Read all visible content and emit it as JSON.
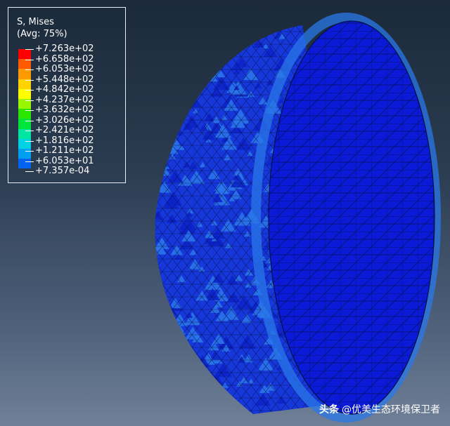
{
  "legend": {
    "variable": "S, Mises",
    "averaging": "(Avg: 75%)",
    "levels": [
      {
        "label": "+7.263e+02",
        "color": "#ff0000"
      },
      {
        "label": "+6.658e+02",
        "color": "#ff5a00"
      },
      {
        "label": "+6.053e+02",
        "color": "#ff9a00"
      },
      {
        "label": "+5.448e+02",
        "color": "#ffd200"
      },
      {
        "label": "+4.842e+02",
        "color": "#ffff00"
      },
      {
        "label": "+4.237e+02",
        "color": "#9af500"
      },
      {
        "label": "+3.632e+02",
        "color": "#2ce600"
      },
      {
        "label": "+3.026e+02",
        "color": "#00e43c"
      },
      {
        "label": "+2.421e+02",
        "color": "#00e6a2"
      },
      {
        "label": "+1.816e+02",
        "color": "#00d2e6"
      },
      {
        "label": "+1.211e+02",
        "color": "#00a0f0"
      },
      {
        "label": "+6.053e+01",
        "color": "#0064f0"
      },
      {
        "label": "+7.357e-04",
        "color": "#0028ec"
      }
    ]
  },
  "model": {
    "face_color": "#0a1ad6",
    "shell_color": "#1637d9",
    "hotspot_color": "#2a78ea",
    "mesh_color": "#051048"
  },
  "watermark": {
    "brand": "头条",
    "handle": "@优美生态环境保卫者"
  }
}
